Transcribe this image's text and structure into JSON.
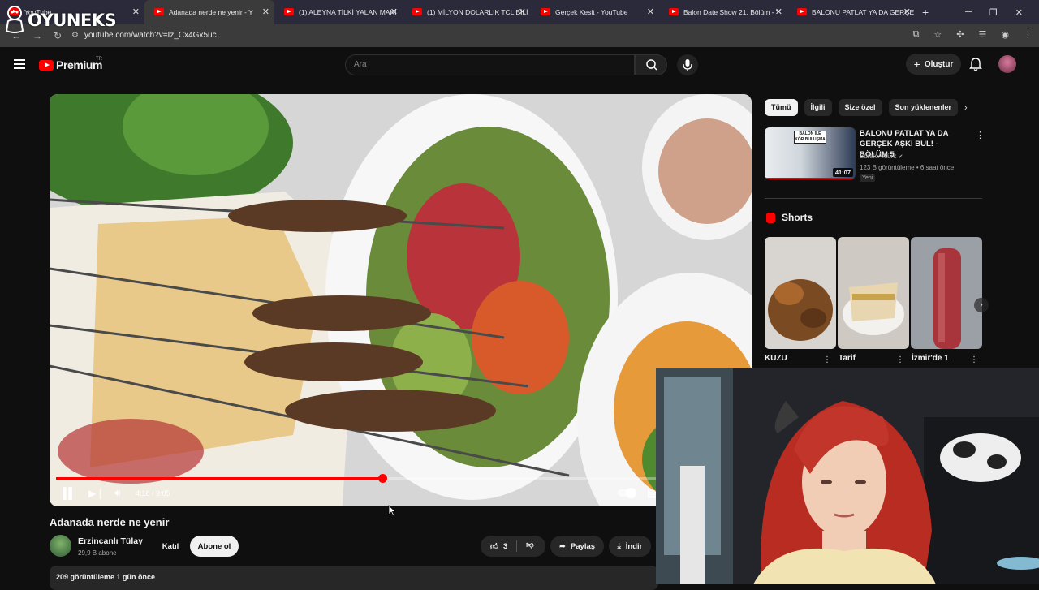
{
  "browser": {
    "tabs": [
      {
        "title": "YouTube",
        "active": false
      },
      {
        "title": "Adanada nerde ne yenir - Y",
        "active": true
      },
      {
        "title": "(1) ALEYNA TİLKİ YALAN MAKİ",
        "active": false
      },
      {
        "title": "(1) MİLYON DOLARLIK TCL BİLİ",
        "active": false
      },
      {
        "title": "Gerçek Kesit - YouTube",
        "active": false
      },
      {
        "title": "Balon Date Show 21. Bölüm - Y",
        "active": false
      },
      {
        "title": "BALONU PATLAT YA DA GERÇE",
        "active": false
      }
    ],
    "url": "youtube.com/watch?v=Iz_Cx4Gx5uc"
  },
  "watermark": {
    "text": "OYUNEKS"
  },
  "masthead": {
    "logo_text": "Premium",
    "logo_sup": "TR",
    "search_placeholder": "Ara",
    "create_label": "Oluştur"
  },
  "player": {
    "time_current": "4:18",
    "time_total": "9:05",
    "time_display": "4:18 / 9:05",
    "progress_fraction": 0.474
  },
  "video": {
    "title": "Adanada nerde ne yenir",
    "channel": "Erzincanlı Tülay",
    "subscribers": "29,9 B abone",
    "join_label": "Katıl",
    "subscribe_label": "Abone ol",
    "likes": "3",
    "share_label": "Paylaş",
    "download_label": "İndir",
    "meta": "209 görüntüleme  1 gün önce"
  },
  "sidebar": {
    "chips": [
      "Tümü",
      "İlgili",
      "Size özel",
      "Son yüklenenler"
    ],
    "recommended": {
      "thumb_text": "BALON İLE KÖR BULUŞMA",
      "duration": "41:07",
      "title": "BALONU PATLAT YA DA GERÇEK AŞKI BUL! - BÖLÜM 5",
      "channel": "Burak Aktürk",
      "stats": "123 B görüntüleme • 6 saat önce",
      "badge": "Yeni"
    },
    "shorts_heading": "Shorts",
    "shorts": [
      {
        "label": "KUZU"
      },
      {
        "label": "Tarif"
      },
      {
        "label": "İzmir'de 1"
      }
    ]
  },
  "colors": {
    "accent": "#ff0000",
    "background": "#0f0f0f",
    "surface": "#272727"
  }
}
